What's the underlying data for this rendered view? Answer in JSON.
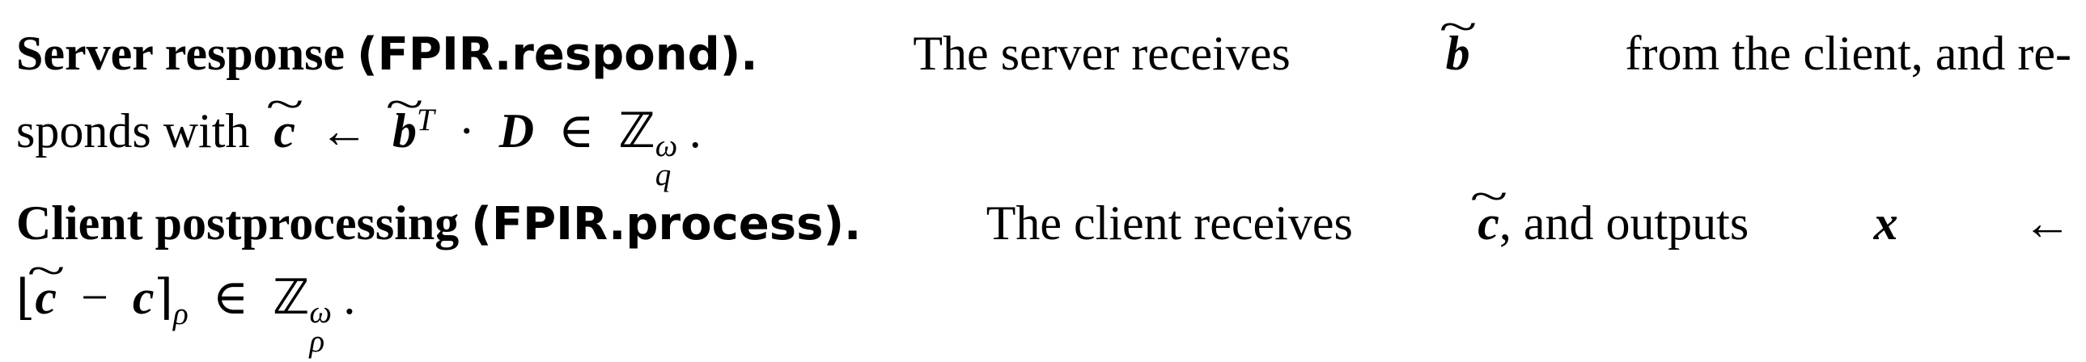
{
  "paragraph1": {
    "heading": "Server response",
    "algorithm": "(FPIR.respond).",
    "sentence_a": "The server receives",
    "var_b": "b",
    "sentence_b": "from the client, and re-",
    "line2_prefix": "sponds with",
    "var_c": "c",
    "arrow": "←",
    "var_b2": "b",
    "transpose": "T",
    "dot": "·",
    "var_D": "D",
    "in": "∈",
    "field": "ℤ",
    "field_sup": "ω",
    "field_sub": "q",
    "end": "."
  },
  "paragraph2": {
    "heading": "Client postprocessing",
    "algorithm": "(FPIR.process).",
    "sentence_a": "The client receives",
    "var_c": "c",
    "sentence_b": ", and outputs",
    "var_x": "x",
    "arrow": "←",
    "lfloor": "⌊",
    "var_c2": "c",
    "minus": "−",
    "var_c3": "c",
    "rceil": "⌉",
    "round_sub": "ρ",
    "in": "∈",
    "field": "ℤ",
    "field_sup": "ω",
    "field_sub": "ρ",
    "end": "."
  }
}
